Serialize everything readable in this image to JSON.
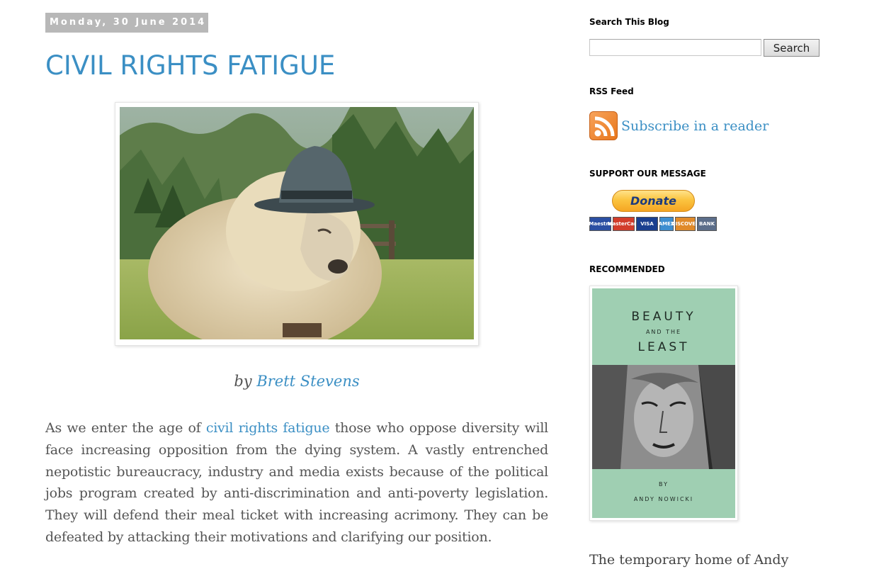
{
  "post": {
    "date": "Monday, 30 June 2014",
    "title": "CIVIL RIGHTS FATIGUE",
    "byline_prefix": "by ",
    "author": "Brett Stevens",
    "body_before_link": "As we enter the age of ",
    "body_link": "civil rights fatigue",
    "body_after_link": " those who oppose diversity will face increasing opposition from the dying system. A vastly entrenched nepotistic bureaucracy, industry and media exists because of the political jobs program created by anti-discrimination and anti-poverty legislation. They will defend their meal ticket with increasing acrimony. They can be defeated by attacking their motivations and clarifying our position."
  },
  "sidebar": {
    "search": {
      "title": "Search This Blog",
      "button_label": "Search",
      "value": ""
    },
    "rss": {
      "title": "RSS Feed",
      "link_text": "Subscribe in a reader"
    },
    "support": {
      "title": "SUPPORT OUR MESSAGE",
      "donate_label": "Donate",
      "cards": [
        "Maestro",
        "MasterCard",
        "VISA",
        "AMEX",
        "DISCOVER",
        "BANK"
      ]
    },
    "recommended": {
      "title": "RECOMMENDED",
      "book_title_1": "BEAUTY",
      "book_title_2": "AND THE",
      "book_title_3": "LEAST",
      "book_by": "BY",
      "book_author": "ANDY NOWICKI"
    },
    "footer_text": "The temporary home of Andy"
  },
  "colors": {
    "link": "#3b8fc4",
    "date_header_bg": "#b8b8b8",
    "book_cover": "#9fcfb2"
  }
}
